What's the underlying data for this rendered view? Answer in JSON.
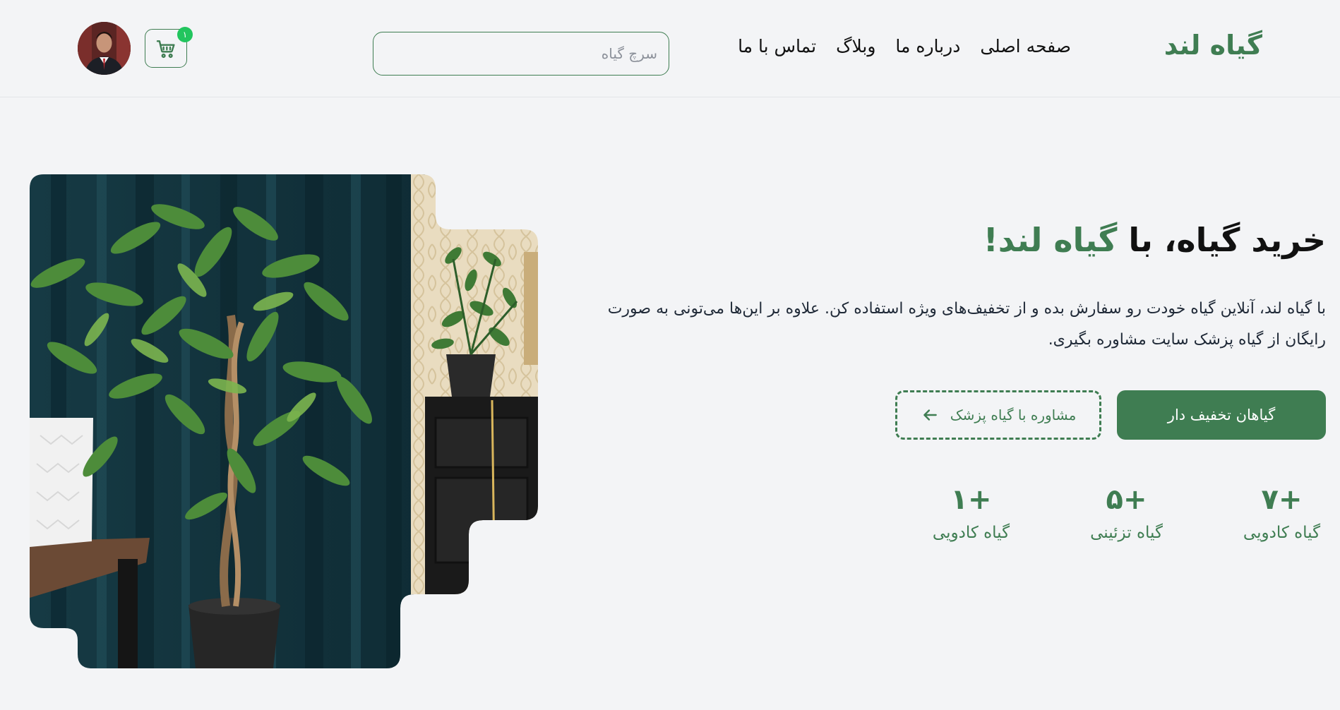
{
  "header": {
    "brand": "گیاه لند",
    "nav": [
      "صفحه اصلی",
      "درباره ما",
      "وبلاگ",
      "تماس با ما"
    ],
    "search_placeholder": "سرچ گیاه",
    "cart_count": "۱"
  },
  "hero": {
    "title_part1": "خرید گیاه، با ",
    "title_accent": "گیاه لند!",
    "description": "با گیاه لند، آنلاین گیاه خودت رو سفارش بده و از تخفیف‌های ویژه استفاده کن. علاوه بر این‌ها می‌تونی به صورت رایگان از گیاه پزشک سایت مشاوره بگیری.",
    "primary_button": "گیاهان تخفیف دار",
    "secondary_button": "مشاوره با گیاه پزشک",
    "stats": [
      {
        "value": "+۷",
        "label": "گیاه کادویی"
      },
      {
        "value": "+۵",
        "label": "گیاه تزئینی"
      },
      {
        "value": "+۱",
        "label": "گیاه کادویی"
      }
    ]
  },
  "colors": {
    "accent": "#3f7d52",
    "badge": "#22c55e",
    "background": "#f3f4f6"
  },
  "icons": {
    "cart": "shopping-cart-icon",
    "secondary_button": "arrow-left-icon"
  }
}
